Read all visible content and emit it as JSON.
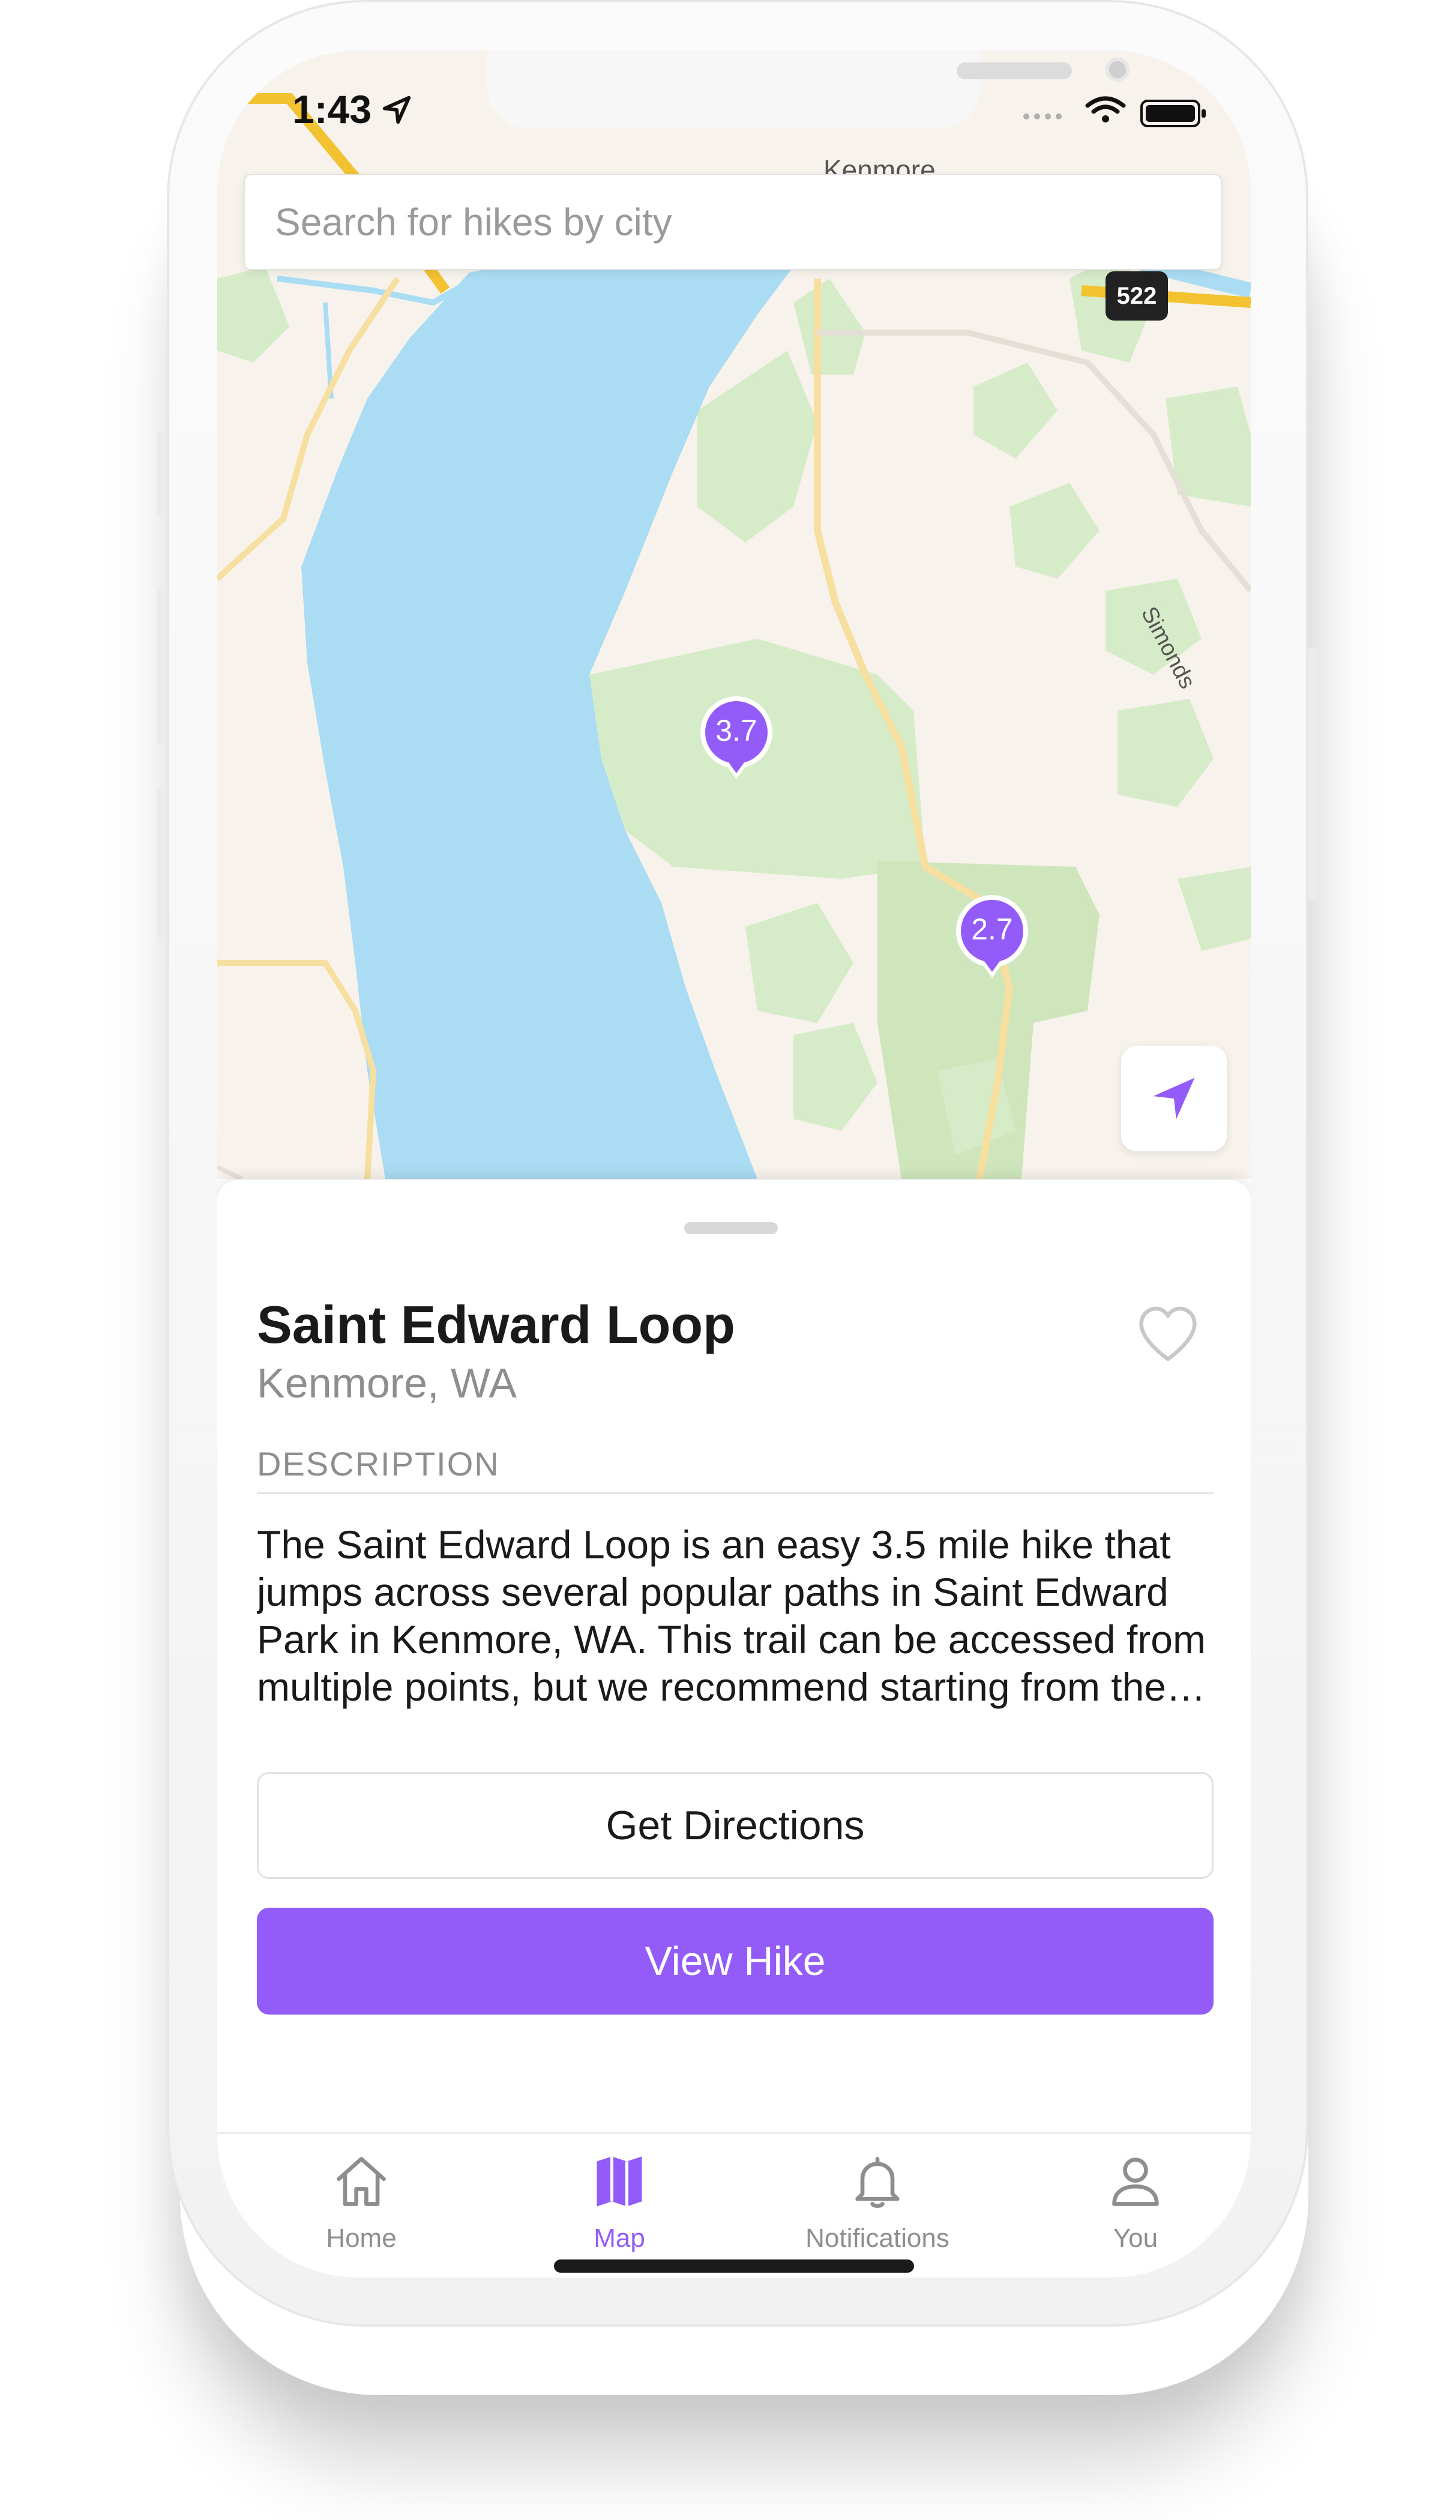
{
  "status_bar": {
    "time": "1:43"
  },
  "search": {
    "placeholder": "Search for hikes by city"
  },
  "map": {
    "labels": {
      "town": "Kenmore",
      "road": "Simonds",
      "route_shield": "522"
    },
    "pins": [
      {
        "value": "3.7"
      },
      {
        "value": "2.7"
      }
    ],
    "icons": {
      "locate": "location-arrow-icon"
    }
  },
  "trail": {
    "title": "Saint Edward Loop",
    "location": "Kenmore, WA",
    "description_heading": "DESCRIPTION",
    "description": "The Saint Edward Loop is an easy 3.5 mile hike that jumps across several popular paths in Saint Edward Park in Kenmore, WA. This trail can be accessed from multiple points, but we recommend starting from the main parking lot near the park entrance.",
    "favorite_icon": "heart-icon"
  },
  "actions": {
    "directions_label": "Get Directions",
    "view_label": "View Hike"
  },
  "tabs": [
    {
      "label": "Home",
      "icon": "home-icon",
      "active": false
    },
    {
      "label": "Map",
      "icon": "map-icon",
      "active": true
    },
    {
      "label": "Notifications",
      "icon": "bell-icon",
      "active": false
    },
    {
      "label": "You",
      "icon": "person-icon",
      "active": false
    }
  ],
  "colors": {
    "accent": "#935cf8",
    "water": "#aadcf3",
    "park": "#d6ebc8",
    "land": "#f7f3ec",
    "road": "#f7dfa0"
  }
}
